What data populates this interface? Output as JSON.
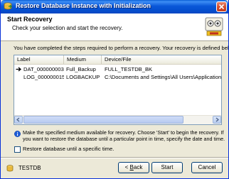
{
  "window": {
    "title": "Restore Database Instance with Initialization"
  },
  "header": {
    "title": "Start Recovery",
    "subtitle": "Check your selection and start the recovery."
  },
  "intro": "You have completed the steps required to perform a recovery. Your recovery is defined below:",
  "table": {
    "columns": [
      "Label",
      "Medium",
      "Device/File"
    ],
    "rows": [
      {
        "label": "DAT_000000003",
        "medium": "Full_Backup",
        "device": "FULL_TESTDB_BK",
        "current": true
      },
      {
        "label": "LOG_000000015",
        "medium": "LOGBACKUP",
        "device": "C:\\Documents and Settings\\All Users\\Application Data\\",
        "current": false
      }
    ]
  },
  "info": "Make the specified medium available for recovery. Choose 'Start' to begin the recovery. If you want to restore the database until a particular point in time, specify the date and time.",
  "checkbox": {
    "label": "Restore database until a specific time.",
    "checked": false
  },
  "footer": {
    "database": "TESTDB",
    "back_prefix": "< ",
    "back_hotkey": "B",
    "back_rest": "ack",
    "start": "Start",
    "cancel": "Cancel"
  },
  "colors": {
    "titlebar": "#0a57d8",
    "window_bg": "#ece9d8",
    "button_border": "#003c74"
  },
  "icons": {
    "title": "database-restore-icon",
    "header": "wizard-graphic-icon",
    "row_current": "arrow-right-icon",
    "info": "info-icon",
    "database": "database-icon"
  }
}
